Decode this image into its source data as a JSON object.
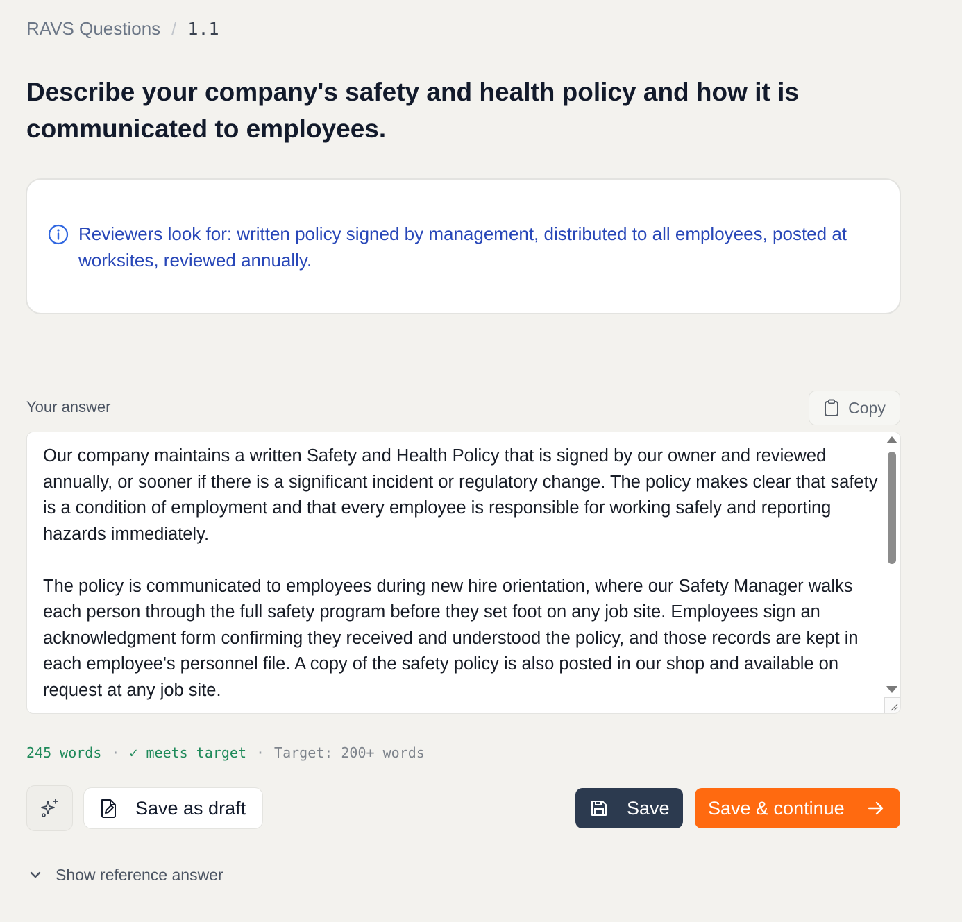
{
  "breadcrumb": {
    "parent": "RAVS Questions",
    "separator": "/",
    "current": "1.1"
  },
  "question": {
    "title": "Describe your company's safety and health policy and how it is communicated to employees."
  },
  "reviewer_hint": {
    "icon": "info-icon",
    "text": "Reviewers look for: written policy signed by management, distributed to all employees, posted at worksites, reviewed annually."
  },
  "answer": {
    "label": "Your answer",
    "copy_label": "Copy",
    "copy_icon": "clipboard-icon",
    "text": "Our company maintains a written Safety and Health Policy that is signed by our owner and reviewed annually, or sooner if there is a significant incident or regulatory change. The policy makes clear that safety is a condition of employment and that every employee is responsible for working safely and reporting hazards immediately.\n\nThe policy is communicated to employees during new hire orientation, where our Safety Manager walks each person through the full safety program before they set foot on any job site. Employees sign an acknowledgment form confirming they received and understood the policy, and those records are kept in each employee's personnel file. A copy of the safety policy is also posted in our shop and available on request at any job site."
  },
  "stats": {
    "word_count": "245 words",
    "status": "✓ meets target",
    "target": "Target: 200+ words",
    "separator": "·"
  },
  "actions": {
    "ai_icon": "sparkles-icon",
    "draft_label": "Save as draft",
    "draft_icon": "file-pen-icon",
    "save_label": "Save",
    "save_icon": "floppy-disk-icon",
    "continue_label": "Save & continue",
    "continue_icon": "arrow-right-icon"
  },
  "reference": {
    "label": "Show reference answer",
    "icon": "chevron-down-icon"
  },
  "colors": {
    "background": "#f3f2ee",
    "hint_text": "#2847b8",
    "save_button": "#2c3a4f",
    "continue_button": "#ff6a10",
    "success_text": "#1f8a5a"
  }
}
